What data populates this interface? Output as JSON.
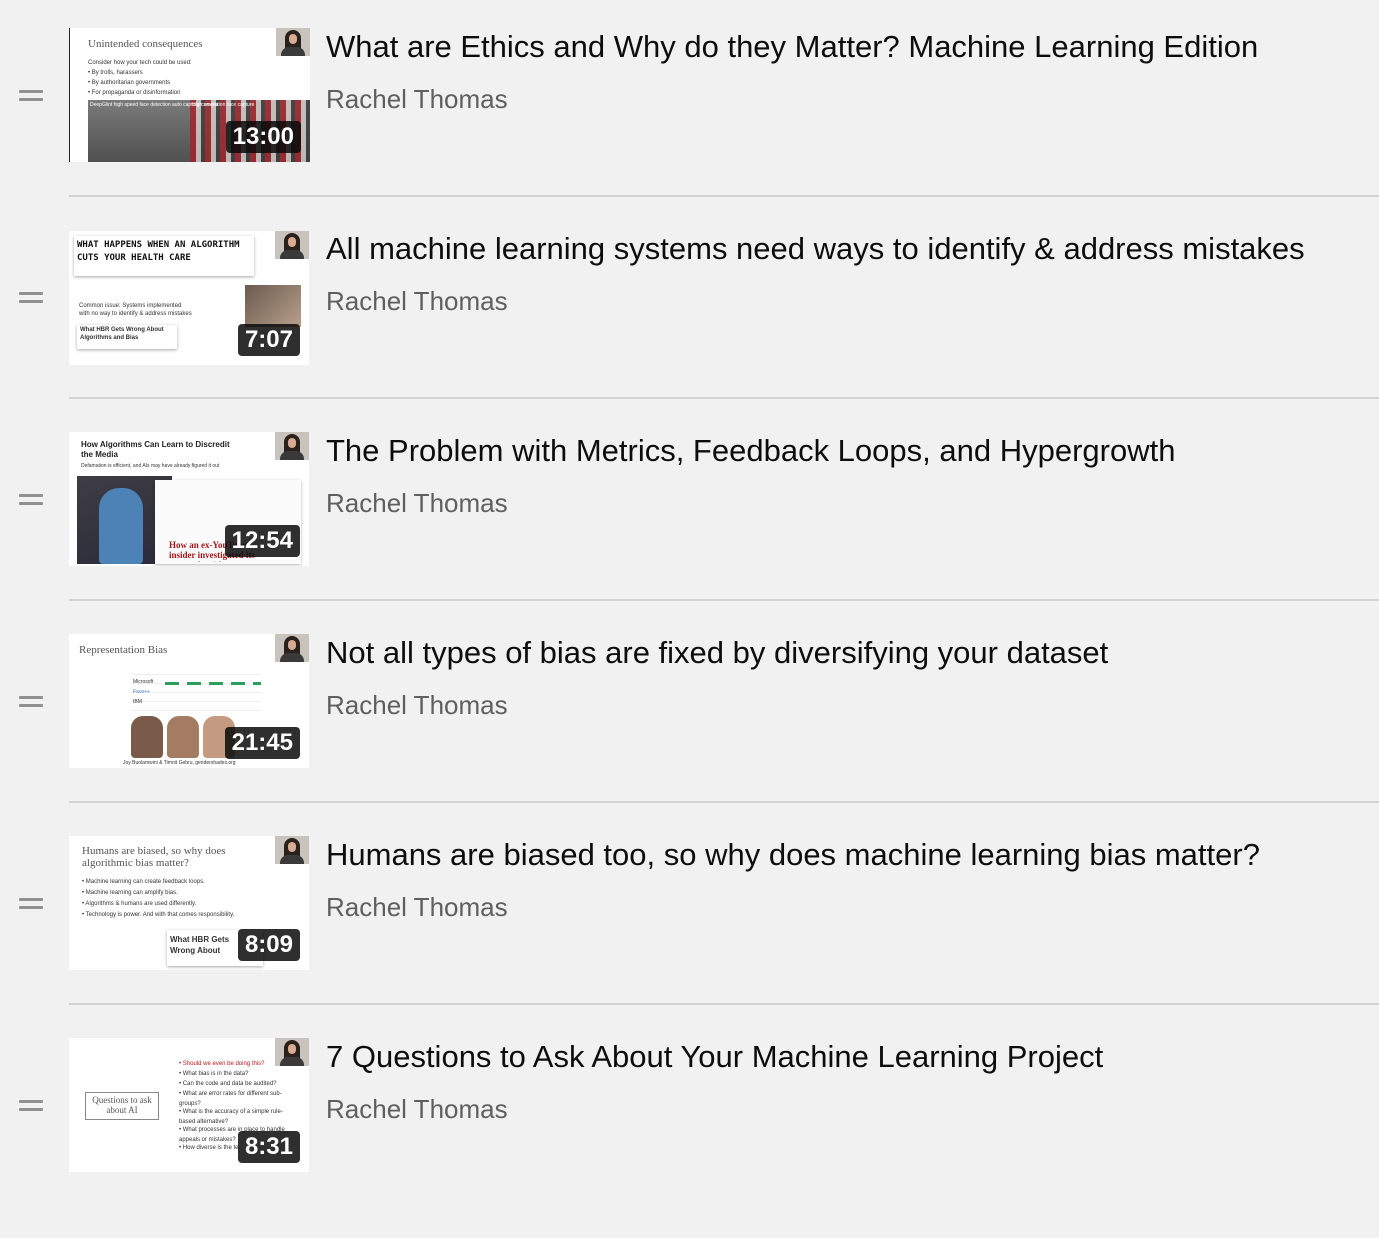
{
  "playlist": {
    "videos": [
      {
        "title": "What are Ethics and Why do they Matter? Machine Learning Edition",
        "channel": "Rachel Thomas",
        "duration": "13:00",
        "thumb_heading": "Unintended consequences",
        "thumb_lines": [
          "Consider how your tech could be used:",
          "• By trolls, harassers",
          "• By authoritarian governments",
          "• For propaganda or disinformation"
        ],
        "thumb_caption_left": "DeepGlint high speed face detection auto capture camera",
        "thumb_caption_right": "High resolution face capture"
      },
      {
        "title": "All machine learning systems need ways to identify & address mistakes",
        "channel": "Rachel Thomas",
        "duration": "7:07",
        "thumb_heading": "WHAT HAPPENS WHEN AN ALGORITHM CUTS YOUR HEALTH CARE",
        "thumb_lines": [
          "Common issue: Systems implemented",
          "with no way to identify & address mistakes"
        ],
        "thumb_card": "What HBR Gets Wrong About Algorithms and Bias"
      },
      {
        "title": "The Problem with Metrics, Feedback Loops, and Hypergrowth",
        "channel": "Rachel Thomas",
        "duration": "12:54",
        "thumb_heading": "How Algorithms Can Learn to Discredit the Media",
        "thumb_lines": [
          "Defamation is efficient, and AIs may have already figured it out"
        ],
        "thumb_card": "How an ex-YouTube insider investigated its secret algorithm"
      },
      {
        "title": "Not all types of bias are fixed by diversifying your dataset",
        "channel": "Rachel Thomas",
        "duration": "21:45",
        "thumb_heading": "Representation Bias",
        "thumb_lines": [
          "Microsoft",
          "Face++",
          "IBM"
        ],
        "thumb_caption_bottom": "Joy Buolamwini & Timnit Gebru, gendershades.org"
      },
      {
        "title": "Humans are biased too, so why does machine learning bias matter?",
        "channel": "Rachel Thomas",
        "duration": "8:09",
        "thumb_heading": "Humans are biased, so why does algorithmic bias matter?",
        "thumb_lines": [
          "• Machine learning can create feedback loops.",
          "• Machine learning can amplify bias.",
          "• Algorithms & humans are used differently.",
          "• Technology is power. And with that comes responsibility."
        ],
        "thumb_card": "What HBR Gets Wrong About Algorithms and Bias"
      },
      {
        "title": "7 Questions to Ask About Your Machine Learning Project",
        "channel": "Rachel Thomas",
        "duration": "8:31",
        "thumb_heading": "Questions to ask about AI",
        "thumb_lines": [
          "• Should we even be doing this?",
          "• What bias is in the data?",
          "• Can the code and data be audited?",
          "• What are error rates for different sub-groups?",
          "• What is the accuracy of a simple rule-based alternative?",
          "• What processes are in place to handle appeals or mistakes?",
          "• How diverse is the team that built it?"
        ]
      }
    ]
  }
}
